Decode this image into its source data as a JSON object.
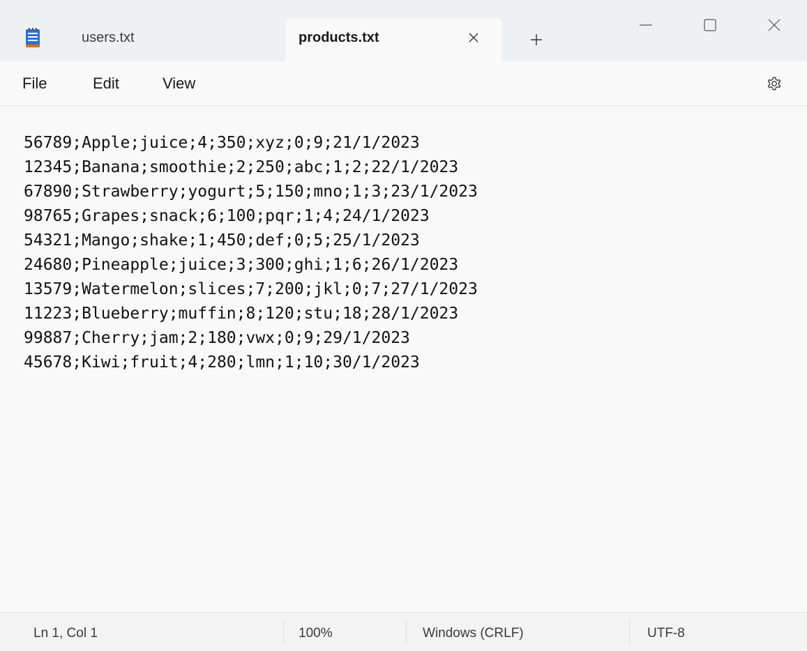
{
  "window": {
    "tabs": [
      {
        "label": "users.txt",
        "active": false
      },
      {
        "label": "products.txt",
        "active": true
      }
    ],
    "accent": "#2f6fd1"
  },
  "menu": {
    "file": "File",
    "edit": "Edit",
    "view": "View"
  },
  "editor": {
    "content": "56789;Apple;juice;4;350;xyz;0;9;21/1/2023\n12345;Banana;smoothie;2;250;abc;1;2;22/1/2023\n67890;Strawberry;yogurt;5;150;mno;1;3;23/1/2023\n98765;Grapes;snack;6;100;pqr;1;4;24/1/2023\n54321;Mango;shake;1;450;def;0;5;25/1/2023\n24680;Pineapple;juice;3;300;ghi;1;6;26/1/2023\n13579;Watermelon;slices;7;200;jkl;0;7;27/1/2023\n11223;Blueberry;muffin;8;120;stu;18;28/1/2023\n99887;Cherry;jam;2;180;vwx;0;9;29/1/2023\n45678;Kiwi;fruit;4;280;lmn;1;10;30/1/2023"
  },
  "status": {
    "position": "Ln 1, Col 1",
    "zoom": "100%",
    "line_ending": "Windows (CRLF)",
    "encoding": "UTF-8"
  },
  "icons": {
    "app": "notepad-icon",
    "close_tab": "close-icon",
    "new_tab": "plus-icon",
    "minimize": "minimize-icon",
    "maximize": "maximize-icon",
    "close_window": "close-icon",
    "settings": "gear-icon"
  }
}
